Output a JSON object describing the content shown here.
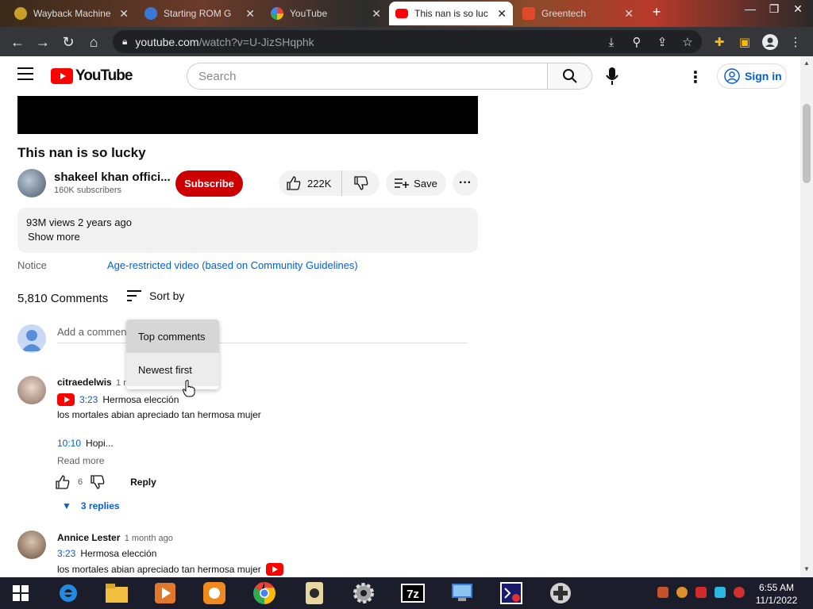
{
  "browser": {
    "tabs": [
      {
        "label": "Wayback Machine",
        "active": false
      },
      {
        "label": "Starting ROM G",
        "active": false
      },
      {
        "label": "YouTube",
        "active": false
      },
      {
        "label": "This nan is so luc",
        "active": true
      },
      {
        "label": "Greentech",
        "active": false
      }
    ],
    "new_tab": "+",
    "url_domain": "youtube.com",
    "url_path": "/watch?v=U-JizSHqphk"
  },
  "youtube": {
    "logo_text": "YouTube",
    "search_placeholder": "Search",
    "sign_in": "Sign in",
    "video": {
      "title": "This nan is so lucky",
      "channel_name": "shakeel khan offici...",
      "subscribers": "160K subscribers",
      "subscribe": "Subscribe",
      "likes": "222K",
      "save": "Save",
      "more": "···",
      "views_age": "93M views  2 years ago",
      "show_more": "Show more",
      "notice_label": "Notice",
      "notice_value": "Age-restricted video (based on Community Guidelines)"
    },
    "comments": {
      "count": "5,810 Comments",
      "sort_by": "Sort by",
      "add_placeholder": "Add a comment",
      "sort_menu": [
        "Top comments",
        "Newest first"
      ],
      "items": [
        {
          "author": "citraedelwis",
          "ago": "1 mo",
          "timestamp": "3:23",
          "text1": "Hermosa elección",
          "text2": "los mortales abian apreciado tan hermosa mujer",
          "timestamp2": "10:10",
          "text3": "Hopi...",
          "read_more": "Read more",
          "likes": "6",
          "reply": "Reply",
          "replies": "3 replies"
        },
        {
          "author": "Annice Lester",
          "ago": "1 month ago",
          "timestamp": "3:23",
          "text1": "Hermosa elección",
          "text2": "los mortales abian apreciado tan hermosa mujer"
        }
      ]
    }
  },
  "taskbar": {
    "time": "6:55 AM",
    "date": "11/1/2022"
  },
  "colors": {
    "youtube_red": "#ff0000",
    "subscribe_red": "#cc0000",
    "link_blue": "#065fd4",
    "toolbar_dark": "#35363a"
  }
}
